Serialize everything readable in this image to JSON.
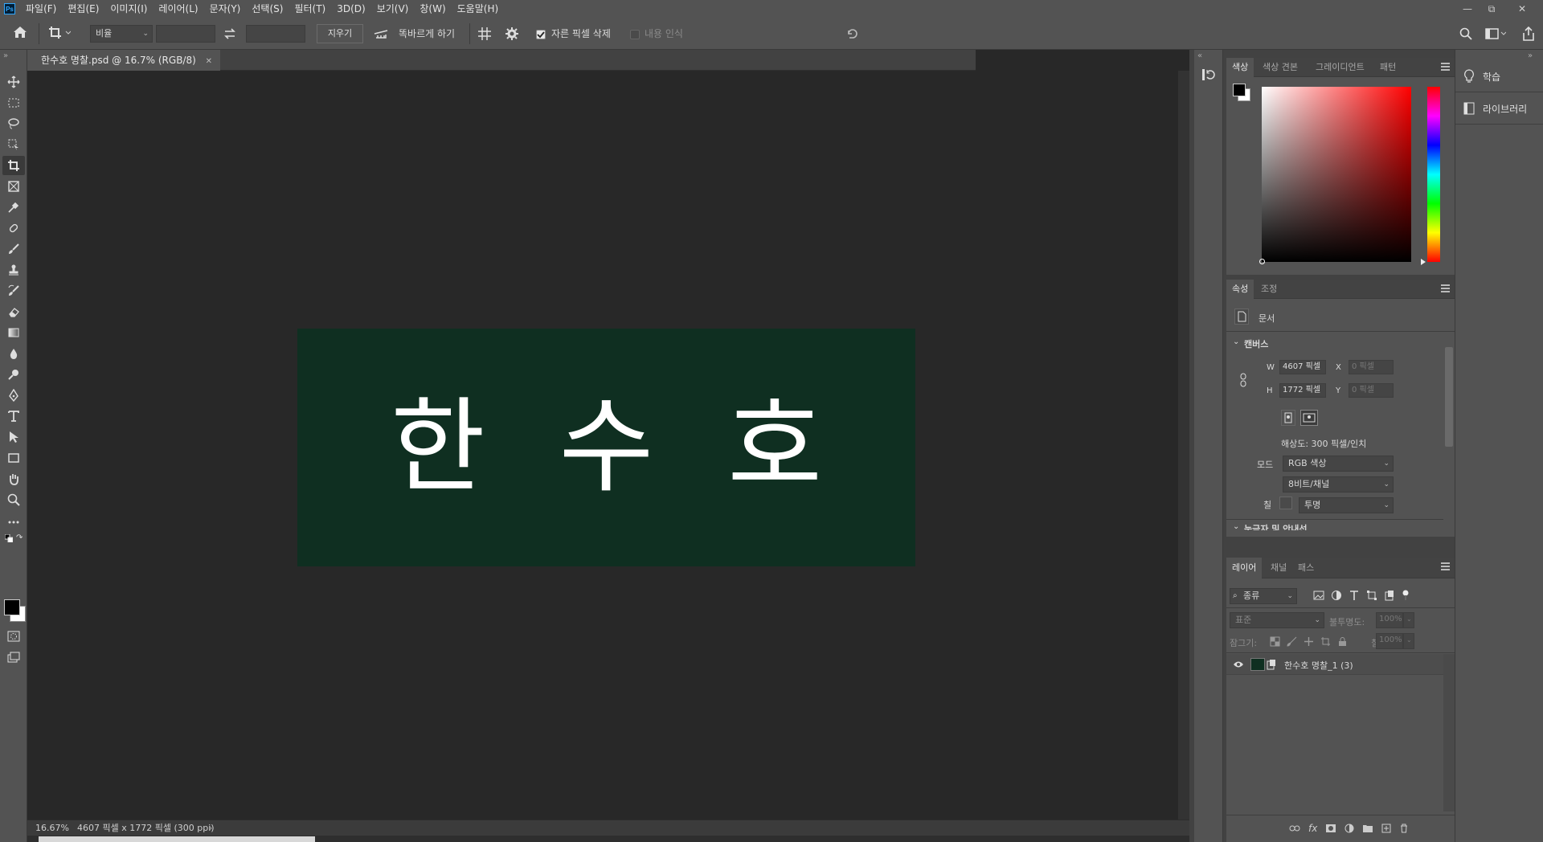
{
  "app": {
    "logo_text": "Ps"
  },
  "menubar": {
    "items": [
      "파일(F)",
      "편집(E)",
      "이미지(I)",
      "레이어(L)",
      "문자(Y)",
      "선택(S)",
      "필터(T)",
      "3D(D)",
      "보기(V)",
      "창(W)",
      "도움말(H)"
    ]
  },
  "options": {
    "ratio_select": "비율",
    "clear_button": "지우기",
    "straighten_label": "똑바르게 하기",
    "delete_cropped_label": "자른 픽셀 삭제",
    "delete_cropped_checked": true,
    "content_aware_label": "내용 인식",
    "content_aware_checked": false
  },
  "document": {
    "tab_title": "한수호 명찰.psd @ 16.7% (RGB/8)",
    "canvas_text": [
      "한",
      "수",
      "호"
    ],
    "canvas_bg": "#0f2f21"
  },
  "status": {
    "zoom": "16.67%",
    "info": "4607 픽셀 x 1772 픽셀 (300 ppi)"
  },
  "color_panel": {
    "tabs": [
      "색상",
      "색상 견본",
      "그레이디언트",
      "패턴"
    ],
    "active_tab": "색상",
    "hue_color": "#ff0000",
    "foreground": "#000000",
    "background": "#ffffff"
  },
  "properties_panel": {
    "tabs": [
      "속성",
      "조정"
    ],
    "doc_label": "문서",
    "section_canvas": "캔버스",
    "w_label": "W",
    "w_value": "4607 픽셀",
    "h_label": "H",
    "h_value": "1772 픽셀",
    "x_label": "X",
    "x_value": "0 픽셀",
    "y_label": "Y",
    "y_value": "0 픽셀",
    "resolution": "해상도: 300 픽셀/인치",
    "mode_label": "모드",
    "mode_value": "RGB 색상",
    "bit_value": "8비트/채널",
    "fill_label": "칠",
    "fill_value": "투명",
    "section_next": "눈금자 및 안내선"
  },
  "layers_panel": {
    "tabs": [
      "레이어",
      "채널",
      "패스"
    ],
    "filter_kind": "종류",
    "blend_mode": "표준",
    "opacity_label": "불투명도:",
    "opacity_value": "100%",
    "lock_label": "잠그기:",
    "fill_label": "칠:",
    "fill_value": "100%",
    "layers": [
      {
        "name": "한수호 명찰_1 (3)",
        "visible": true
      }
    ]
  },
  "right_dock": {
    "items": [
      "학습",
      "라이브러리"
    ]
  }
}
